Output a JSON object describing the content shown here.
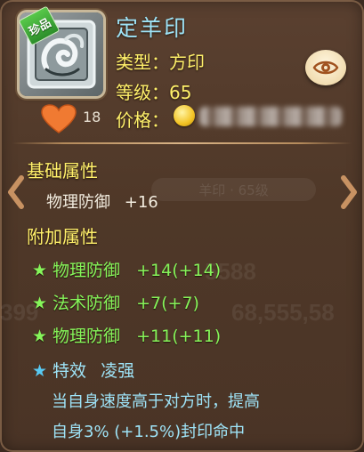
{
  "item": {
    "name": "定羊印",
    "rarity_tag": "珍品",
    "type_label": "类型：",
    "type_value": "方印",
    "level_label": "等级：",
    "level_value": "65",
    "likes": "18",
    "price_label": "价格："
  },
  "sections": {
    "base_title": "基础属性",
    "base_attr_name": "物理防御",
    "base_attr_value": "+16",
    "extra_title": "附加属性"
  },
  "extra_attrs": [
    {
      "name": "物理防御",
      "value": "+14(+14)"
    },
    {
      "name": "法术防御",
      "value": "+7(+7)"
    },
    {
      "name": "物理防御",
      "value": "+11(+11)"
    }
  ],
  "special": {
    "label": "特效",
    "name": "凌强",
    "desc_line1": "当自身速度高于对方时，提高",
    "desc_line2": "自身3% (+1.5%)封印命中"
  },
  "ghost_selector": "羊印 · 65级",
  "icons": {
    "rarity": "green-tag",
    "eye": "eye-icon",
    "heart": "heart-icon",
    "coin": "coin-icon",
    "prev": "chevron-left-icon",
    "next": "chevron-right-icon",
    "star_green": "star-icon",
    "star_blue": "star-icon"
  },
  "colors": {
    "name": "#9ee3f7",
    "label": "#fff06a",
    "extra_attr": "#86f55a",
    "special": "#9ee3f7",
    "heart": "#f07a32",
    "star_blue": "#58c9f2"
  }
}
